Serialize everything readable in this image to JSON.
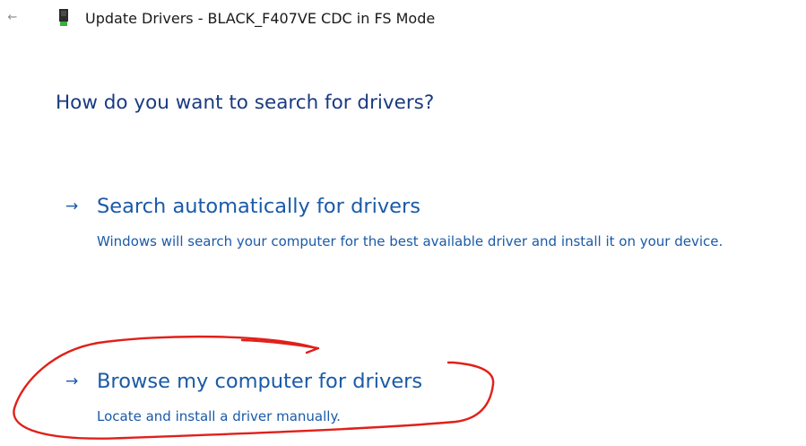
{
  "window": {
    "back_icon": "back-arrow-icon",
    "device_icon": "usb-device-icon",
    "title": "Update Drivers - BLACK_F407VE CDC in FS Mode"
  },
  "main": {
    "heading": "How do you want to search for drivers?",
    "options": [
      {
        "arrow": "→",
        "title": "Search automatically for drivers",
        "description": "Windows will search your computer for the best available driver and install it on your device."
      },
      {
        "arrow": "→",
        "title": "Browse my computer for drivers",
        "description": "Locate and install a driver manually."
      }
    ]
  },
  "colors": {
    "link_blue": "#1a5aa8",
    "heading_blue": "#1a3a80",
    "annotation_red": "#e0201a"
  }
}
